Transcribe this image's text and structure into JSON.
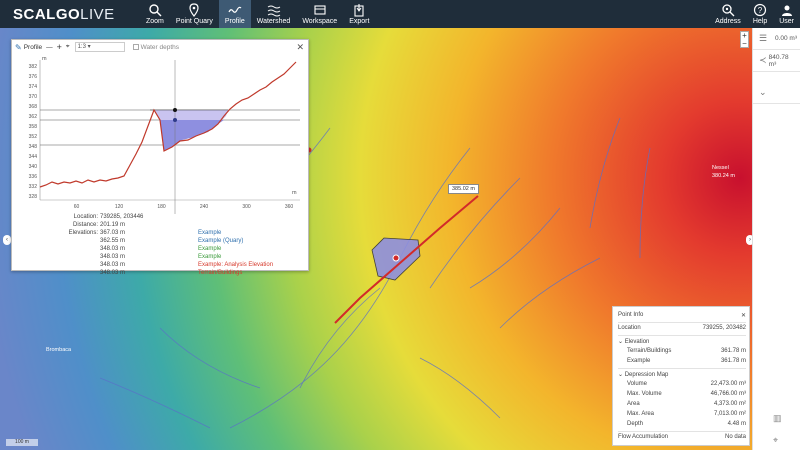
{
  "app": {
    "logo_main": "SCALGO",
    "logo_sub": "LIVE"
  },
  "toolbar": {
    "items": [
      {
        "label": "Zoom",
        "icon": "search-icon"
      },
      {
        "label": "Point Quary",
        "icon": "map-pin-icon"
      },
      {
        "label": "Profile",
        "icon": "profile-wave-icon",
        "active": true
      },
      {
        "label": "Watershed",
        "icon": "watershed-icon"
      },
      {
        "label": "Workspace",
        "icon": "workspace-icon"
      },
      {
        "label": "Export",
        "icon": "export-icon"
      }
    ],
    "right_items": [
      {
        "label": "Address",
        "icon": "address-search-icon"
      },
      {
        "label": "Help",
        "icon": "help-icon"
      },
      {
        "label": "User",
        "icon": "user-icon"
      }
    ]
  },
  "sidepanel": {
    "row1_value": "0.00 m³",
    "row2_value": "840.78 m³"
  },
  "profile": {
    "title": "Profile",
    "minus": "—",
    "plus": "+",
    "scale_select": "1:3",
    "water_depths_label": "Water depths",
    "y_unit": "m",
    "x_unit": "m",
    "y_ticks": [
      "382",
      "376",
      "374",
      "370",
      "368",
      "362",
      "358",
      "352",
      "348",
      "344",
      "340",
      "336",
      "332",
      "328"
    ],
    "x_ticks": [
      "60",
      "120",
      "180",
      "240",
      "300",
      "360"
    ],
    "info": {
      "location_label": "Location:",
      "location_value": "739285, 203446",
      "distance_label": "Distance:",
      "distance_value": "201.19 m",
      "elevations_label": "Elevations:",
      "elevations": [
        {
          "value": "367.03 m",
          "name": "Example",
          "color": "#2e6fad"
        },
        {
          "value": "362.55 m",
          "name": "Example (Quary)",
          "color": "#2e6fad"
        },
        {
          "value": "348.03 m",
          "name": "Example",
          "color": "#3a9a3a"
        },
        {
          "value": "348.03 m",
          "name": "Example",
          "color": "#3a9a3a"
        },
        {
          "value": "348.03 m",
          "name": "Example: Analysis Elevation",
          "color": "#d63a2c"
        },
        {
          "value": "348.03 m",
          "name": "Terrain/Buildings",
          "color": "#d63a2c"
        }
      ]
    }
  },
  "map": {
    "callout": "385.02 m",
    "place_label_1": "Nessel",
    "place_label_2": "380.24 m",
    "place_label_3": "Brombaca",
    "scale_label": "100 m"
  },
  "point_info": {
    "title": "Point Info",
    "location_label": "Location",
    "location_value": "739255, 203482",
    "elevation_section": "Elevation",
    "elevation_rows": [
      {
        "label": "Terrain/Buildings",
        "value": "361.78 m"
      },
      {
        "label": "Example",
        "value": "361.78 m"
      }
    ],
    "depression_section": "Depression Map",
    "depression_rows": [
      {
        "label": "Volume",
        "value": "22,473.00 m³"
      },
      {
        "label": "Max. Volume",
        "value": "46,766.00 m³"
      },
      {
        "label": "Area",
        "value": "4,373.00 m²"
      },
      {
        "label": "Max. Area",
        "value": "7,013.00 m²"
      },
      {
        "label": "Depth",
        "value": "4.48 m"
      }
    ],
    "flow_label": "Flow Accumulation",
    "flow_value": "No data"
  },
  "colors": {
    "topbar": "#1f2d3a",
    "active_tab": "#3e5a74",
    "terrain_line": "#c0392b",
    "water_fill": "#8e8fe0"
  }
}
